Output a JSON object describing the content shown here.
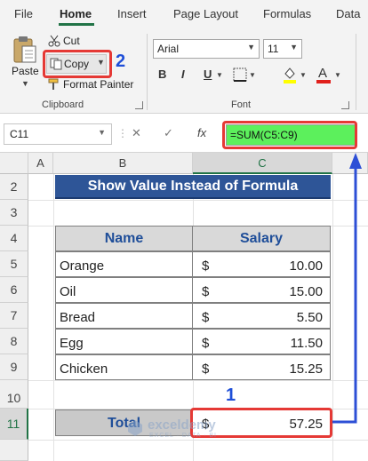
{
  "menu": {
    "tabs": [
      "File",
      "Home",
      "Insert",
      "Page Layout",
      "Formulas",
      "Data"
    ]
  },
  "ribbon": {
    "clipboard": {
      "paste_label": "Paste",
      "cut_label": "Cut",
      "copy_label": "Copy",
      "format_painter_label": "Format Painter",
      "group_label": "Clipboard"
    },
    "font": {
      "font_name": "Arial",
      "font_size": "11",
      "bold": "B",
      "italic": "I",
      "underline": "U",
      "font_color_glyph": "A",
      "group_label": "Font"
    }
  },
  "formula_bar": {
    "name_box": "C11",
    "cancel_glyph": "✕",
    "enter_glyph": "✓",
    "fx_glyph": "fx",
    "formula": "=SUM(C5:C9)"
  },
  "sheet": {
    "columns": [
      "A",
      "B",
      "C"
    ],
    "rows": [
      "2",
      "3",
      "4",
      "5",
      "6",
      "7",
      "8",
      "9",
      "10",
      "11"
    ],
    "title": "Show Value Instead of Formula",
    "headers": {
      "name": "Name",
      "salary": "Salary"
    },
    "items": [
      {
        "name": "Orange",
        "currency": "$",
        "amount": "10.00"
      },
      {
        "name": "Oil",
        "currency": "$",
        "amount": "15.00"
      },
      {
        "name": "Bread",
        "currency": "$",
        "amount": "5.50"
      },
      {
        "name": "Egg",
        "currency": "$",
        "amount": "11.50"
      },
      {
        "name": "Chicken",
        "currency": "$",
        "amount": "15.25"
      }
    ],
    "total": {
      "label": "Total",
      "currency": "$",
      "amount": "57.25"
    }
  },
  "annotations": {
    "step1": "1",
    "step2": "2",
    "highlight_color": "#e53935",
    "arrow_color": "#2d4fd6"
  },
  "watermark": {
    "brand": "exceldemy",
    "tagline": "EXCEL · DATA · BI"
  },
  "colors": {
    "title_fill": "#2e5597",
    "formula_highlight": "#5cf05c",
    "excel_green": "#217346"
  }
}
